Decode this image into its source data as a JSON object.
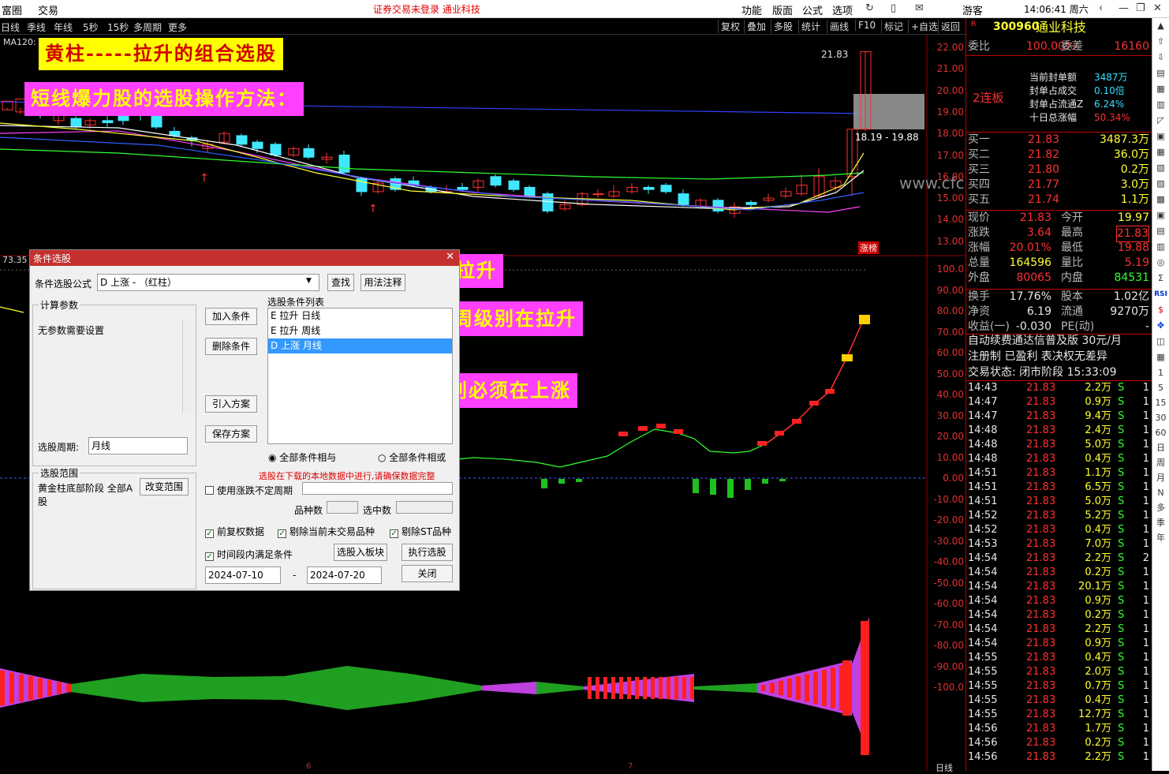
{
  "menubar": {
    "left": [
      "富圈",
      "交易"
    ],
    "notice": "证券交易未登录  通业科技",
    "right": [
      "功能",
      "版面",
      "公式",
      "选项"
    ],
    "user": "游客",
    "time": "14:06:41 周六"
  },
  "toolbar": {
    "periods": [
      "日线",
      "季线",
      "年线",
      "5秒",
      "15秒",
      "多周期",
      "更多"
    ],
    "ma_label": "MA120:",
    "buttons": [
      "复权",
      "叠加",
      "多股",
      "统计",
      "画线",
      "F10",
      "标记",
      "+自选",
      "返回"
    ]
  },
  "annotations": {
    "title1": "黄柱-----拉升的组合选股",
    "title2": "短线爆力股的选股操作方法：",
    "day": "日要拉升",
    "week": "周级别在拉升",
    "month": "月级别必须在上涨"
  },
  "price_axis": [
    "22.00",
    "21.00",
    "20.00",
    "19.00",
    "18.00",
    "17.00",
    "16.00",
    "15.00",
    "14.00",
    "13.00"
  ],
  "price_labels": {
    "high": "21.83",
    "range": "18.19 - 19.88",
    "limit": "涨榜",
    "left_val": "73.35",
    "watermark": "www.cfc.com"
  },
  "indicator_axis": [
    "100.0",
    "90.00",
    "80.00",
    "70.00",
    "60.00",
    "50.00",
    "40.00",
    "30.00",
    "20.00",
    "10.00",
    "0.00",
    "-10.00",
    "-20.00",
    "-30.00",
    "-40.00",
    "-50.00",
    "-60.00",
    "-70.00",
    "-80.00",
    "-90.00",
    "-100.0"
  ],
  "bottom_labels": {
    "m6": "6",
    "m7": "7",
    "period": "日线"
  },
  "stock": {
    "badge": "R",
    "code": "300960",
    "name": "通业科技",
    "weibi_label": "委比",
    "weibi": "100.00%",
    "weicha_label": "委差",
    "weicha": "16160",
    "lianban": "2连板",
    "seal": [
      {
        "label": "当前封单额",
        "value": "3487万"
      },
      {
        "label": "封单占成交",
        "value": "0.10倍"
      },
      {
        "label": "封单占流通Z",
        "value": "6.24%"
      },
      {
        "label": "十日总涨幅",
        "value": "50.34%"
      }
    ],
    "bids": [
      {
        "label": "买一",
        "price": "21.83",
        "vol": "3487.3万"
      },
      {
        "label": "买二",
        "price": "21.82",
        "vol": "36.0万"
      },
      {
        "label": "买三",
        "price": "21.80",
        "vol": "0.2万"
      },
      {
        "label": "买四",
        "price": "21.77",
        "vol": "3.0万"
      },
      {
        "label": "买五",
        "price": "21.74",
        "vol": "1.1万"
      }
    ],
    "quote": [
      {
        "l1": "现价",
        "v1": "21.83",
        "l2": "今开",
        "v2": "19.97"
      },
      {
        "l1": "涨跌",
        "v1": "3.64",
        "l2": "最高",
        "v2": "21.83"
      },
      {
        "l1": "涨幅",
        "v1": "20.01%",
        "l2": "最低",
        "v2": "19.88"
      },
      {
        "l1": "总量",
        "v1": "164596",
        "l2": "量比",
        "v2": "5.19"
      },
      {
        "l1": "外盘",
        "v1": "80065",
        "l2": "内盘",
        "v2": "84531"
      }
    ],
    "fund": [
      {
        "l1": "换手",
        "v1": "17.76%",
        "l2": "股本",
        "v2": "1.02亿"
      },
      {
        "l1": "净资",
        "v1": "6.19",
        "l2": "流通",
        "v2": "9270万"
      },
      {
        "l1": "收益(一)",
        "v1": "-0.030",
        "l2": "PE(动)",
        "v2": "-"
      }
    ],
    "ad": "自动续费通达信普及版  30元/月",
    "reg": "注册制 已盈利 表决权无差异",
    "state": "交易状态: 闭市阶段 15:33:09"
  },
  "ticks": [
    [
      "14:43",
      "21.83",
      "2.2万",
      "S",
      "1"
    ],
    [
      "14:47",
      "21.83",
      "0.9万",
      "S",
      "1"
    ],
    [
      "14:47",
      "21.83",
      "9.4万",
      "S",
      "1"
    ],
    [
      "14:48",
      "21.83",
      "2.4万",
      "S",
      "1"
    ],
    [
      "14:48",
      "21.83",
      "5.0万",
      "S",
      "1"
    ],
    [
      "14:48",
      "21.83",
      "0.4万",
      "S",
      "1"
    ],
    [
      "14:51",
      "21.83",
      "1.1万",
      "S",
      "1"
    ],
    [
      "14:51",
      "21.83",
      "6.5万",
      "S",
      "1"
    ],
    [
      "14:51",
      "21.83",
      "5.0万",
      "S",
      "1"
    ],
    [
      "14:52",
      "21.83",
      "5.2万",
      "S",
      "1"
    ],
    [
      "14:52",
      "21.83",
      "0.4万",
      "S",
      "1"
    ],
    [
      "14:53",
      "21.83",
      "7.0万",
      "S",
      "1"
    ],
    [
      "14:54",
      "21.83",
      "2.2万",
      "S",
      "2"
    ],
    [
      "14:54",
      "21.83",
      "0.2万",
      "S",
      "1"
    ],
    [
      "14:54",
      "21.83",
      "20.1万",
      "S",
      "1"
    ],
    [
      "14:54",
      "21.83",
      "0.9万",
      "S",
      "1"
    ],
    [
      "14:54",
      "21.83",
      "0.2万",
      "S",
      "1"
    ],
    [
      "14:54",
      "21.83",
      "2.2万",
      "S",
      "1"
    ],
    [
      "14:54",
      "21.83",
      "0.9万",
      "S",
      "1"
    ],
    [
      "14:55",
      "21.83",
      "0.4万",
      "S",
      "1"
    ],
    [
      "14:55",
      "21.83",
      "2.0万",
      "S",
      "1"
    ],
    [
      "14:55",
      "21.83",
      "0.7万",
      "S",
      "1"
    ],
    [
      "14:55",
      "21.83",
      "0.4万",
      "S",
      "1"
    ],
    [
      "14:55",
      "21.83",
      "12.7万",
      "S",
      "1"
    ],
    [
      "14:56",
      "21.83",
      "1.7万",
      "S",
      "1"
    ],
    [
      "14:56",
      "21.83",
      "0.2万",
      "S",
      "1"
    ],
    [
      "14:56",
      "21.83",
      "2.2万",
      "S",
      "1"
    ]
  ],
  "sidebar": [
    "1",
    "5",
    "15",
    "30",
    "60",
    "日",
    "周",
    "月",
    "N",
    "多",
    "季",
    "年"
  ],
  "dialog": {
    "title": "条件选股",
    "formula_label": "条件选股公式",
    "formula_value": "D 上涨  - （红柱）",
    "find_btn": "查找",
    "usage_btn": "用法注释",
    "params_title": "计算参数",
    "params_text": "无参数需要设置",
    "add_btn": "加入条件",
    "del_btn": "删除条件",
    "import_btn": "引入方案",
    "save_btn": "保存方案",
    "list_title": "选股条件列表",
    "conditions": [
      "E 拉升  日线",
      "E 拉升  周线",
      "D 上涨  月线"
    ],
    "period_label": "选股周期:",
    "period_value": "月线",
    "and_label": "全部条件相与",
    "or_label": "全部条件相或",
    "warning": "选股在下载的本地数据中进行,请确保数据完整",
    "range_title": "选股范围",
    "range_text": "黄金柱底部阶段 全部A股",
    "range_btn": "改变范围",
    "uncertain_label": "使用涨跌不定周期",
    "count_label": "品种数",
    "selected_label": "选中数",
    "opt1": "前复权数据",
    "opt2": "剔除当前未交易品种",
    "opt3": "剔除ST品种",
    "opt4": "时间段内满足条件",
    "to_board_btn": "选股入板块",
    "run_btn": "执行选股",
    "date_from": "2024-07-10",
    "date_to": "2024-07-20",
    "dash": "-",
    "close_btn": "关闭"
  }
}
